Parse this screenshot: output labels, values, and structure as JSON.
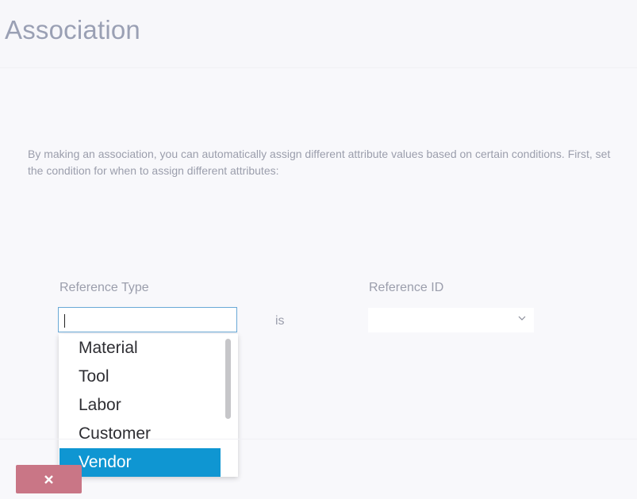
{
  "header": {
    "title": "Association"
  },
  "description": "By making an association, you can automatically assign different attribute values based on certain conditions. First, set the condition for when to assign different attributes:",
  "condition": {
    "reference_type_label": "Reference Type",
    "reference_type_value": "",
    "operator_text": "is",
    "reference_id_label": "Reference ID",
    "reference_id_value": ""
  },
  "dropdown": {
    "options": [
      "Material",
      "Tool",
      "Labor",
      "Customer",
      "Vendor"
    ],
    "highlighted": "Vendor"
  },
  "footer": {
    "cancel_icon": "close-icon"
  },
  "colors": {
    "title": "#9aa0b4",
    "highlight": "#0f96d2",
    "cancel_button": "#c97686",
    "input_border": "#69a9d6"
  }
}
